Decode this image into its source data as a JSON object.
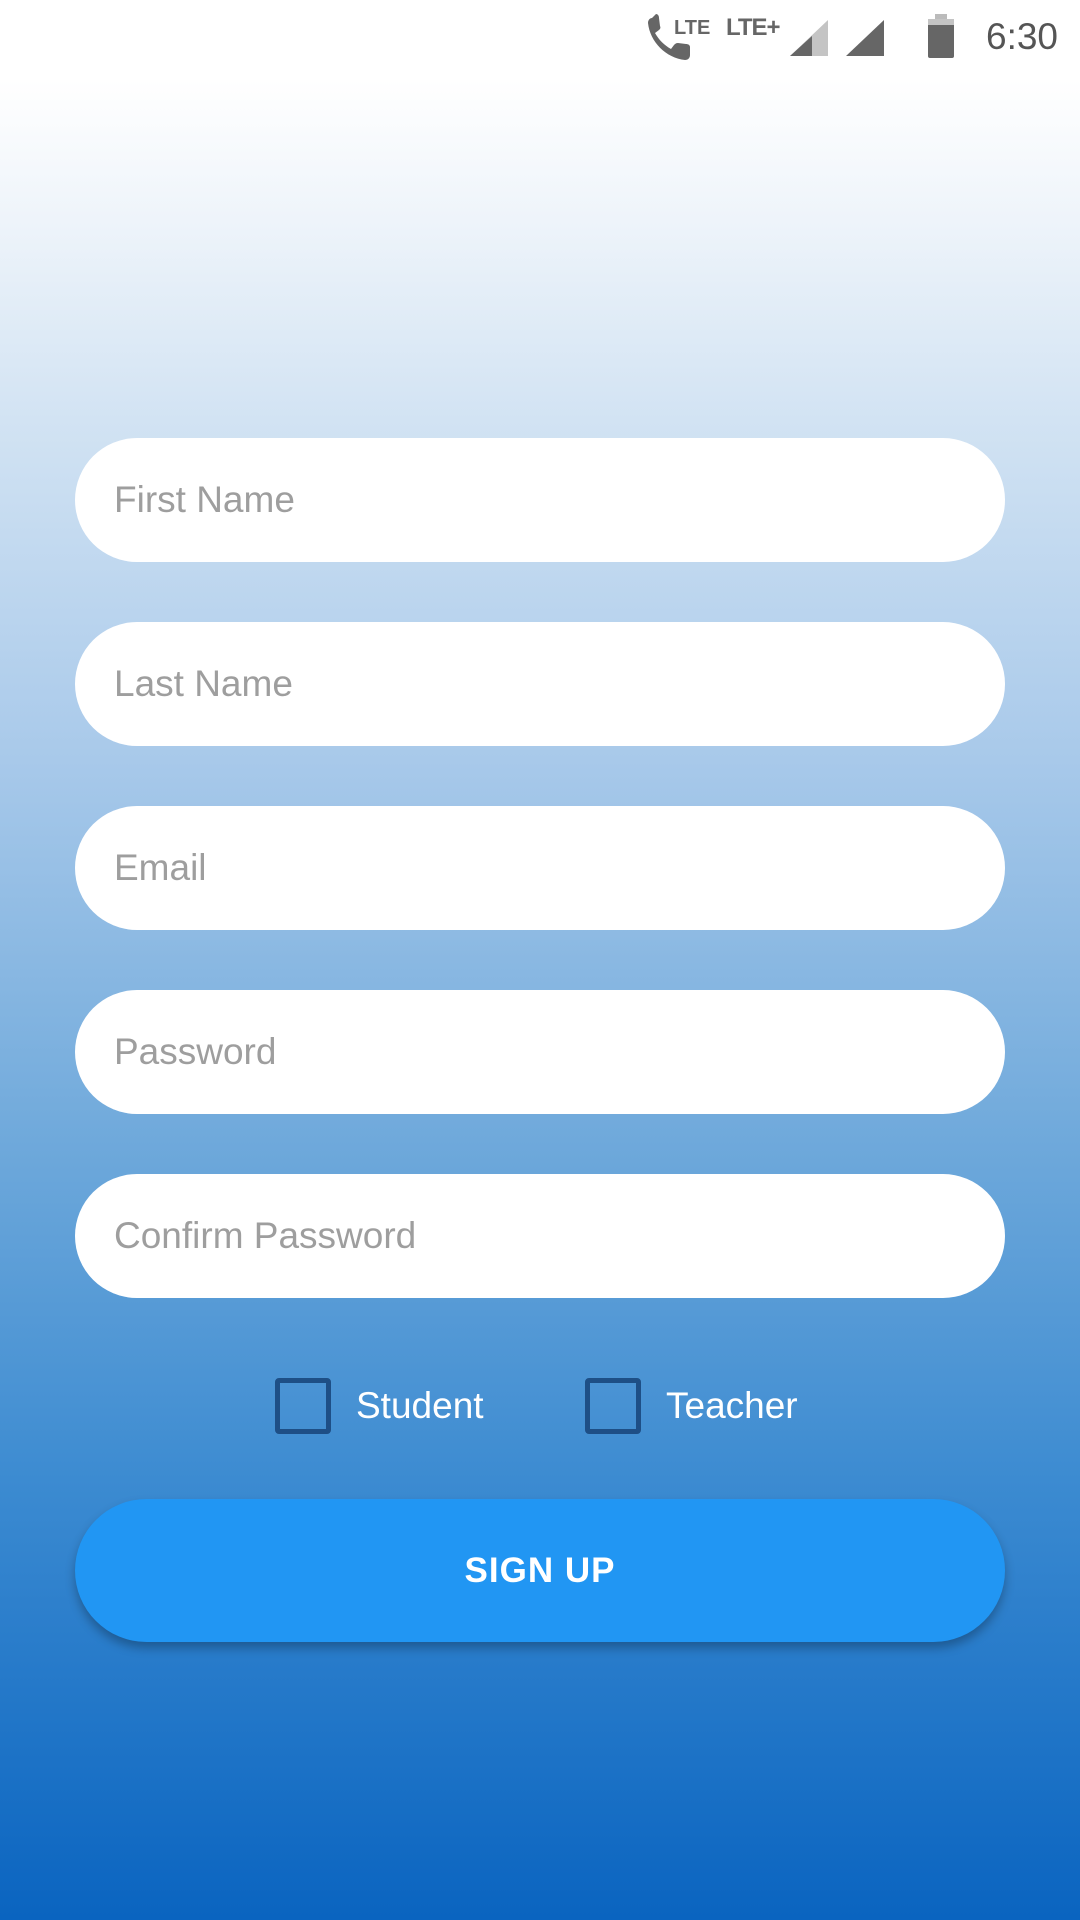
{
  "status_bar": {
    "call_lte_label": "LTE",
    "network_label": "LTE+",
    "time": "6:30",
    "icons": [
      "phone-lte-icon",
      "signal-1-icon",
      "signal-2-icon",
      "battery-icon"
    ]
  },
  "form": {
    "first_name": {
      "placeholder": "First Name",
      "value": ""
    },
    "last_name": {
      "placeholder": "Last Name",
      "value": ""
    },
    "email": {
      "placeholder": "Email",
      "value": ""
    },
    "password": {
      "placeholder": "Password",
      "value": ""
    },
    "confirm_password": {
      "placeholder": "Confirm Password",
      "value": ""
    }
  },
  "roles": {
    "student": {
      "label": "Student",
      "checked": false
    },
    "teacher": {
      "label": "Teacher",
      "checked": false
    }
  },
  "signup_button": {
    "label": "SIGN UP"
  },
  "colors": {
    "accent": "#2196f3",
    "checkbox_border": "#1e4f86",
    "gradient_top": "#ffffff",
    "gradient_bottom": "#0a64c0"
  }
}
